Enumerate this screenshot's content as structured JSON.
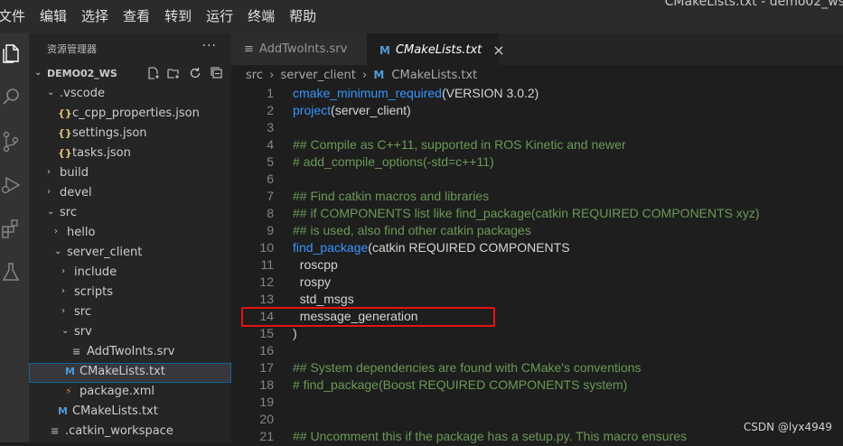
{
  "menubar": [
    "文件",
    "编辑",
    "选择",
    "查看",
    "转到",
    "运行",
    "终端",
    "帮助"
  ],
  "window_title": "CMakeLists.txt - demo02_ws",
  "activity_bar": [
    "explorer-icon",
    "search-icon",
    "source-control-icon",
    "run-debug-icon",
    "extensions-icon",
    "testing-icon"
  ],
  "sidebar": {
    "title": "资源管理器",
    "more": "···",
    "workspace": "DEMO02_WS",
    "tree": [
      {
        "label": ".vscode",
        "chevron": "⌄",
        "icon": ""
      },
      {
        "label": "c_cpp_properties.json",
        "chevron": "",
        "icon": "{}"
      },
      {
        "label": "settings.json",
        "chevron": "",
        "icon": "{}"
      },
      {
        "label": "tasks.json",
        "chevron": "",
        "icon": "{}"
      },
      {
        "label": "build",
        "chevron": "›",
        "icon": ""
      },
      {
        "label": "devel",
        "chevron": "›",
        "icon": ""
      },
      {
        "label": "src",
        "chevron": "⌄",
        "icon": ""
      },
      {
        "label": "hello",
        "chevron": "›",
        "icon": ""
      },
      {
        "label": "server_client",
        "chevron": "⌄",
        "icon": ""
      },
      {
        "label": "include",
        "chevron": "›",
        "icon": ""
      },
      {
        "label": "scripts",
        "chevron": "›",
        "icon": ""
      },
      {
        "label": "src",
        "chevron": "›",
        "icon": ""
      },
      {
        "label": "srv",
        "chevron": "⌄",
        "icon": ""
      },
      {
        "label": "AddTwoInts.srv",
        "chevron": "",
        "icon": "≡"
      },
      {
        "label": "CMakeLists.txt",
        "chevron": "",
        "icon": "M"
      },
      {
        "label": "package.xml",
        "chevron": "",
        "icon": "⚡"
      },
      {
        "label": "CMakeLists.txt",
        "chevron": "",
        "icon": "M"
      },
      {
        "label": ".catkin_workspace",
        "chevron": "",
        "icon": "≡"
      }
    ]
  },
  "tabs": [
    {
      "label": "AddTwoInts.srv",
      "icon": "≡"
    },
    {
      "label": "CMakeLists.txt",
      "icon": "M",
      "close": "×"
    }
  ],
  "breadcrumb": {
    "parts": [
      "src",
      "server_client",
      "CMakeLists.txt"
    ],
    "sep": "›"
  },
  "code_lines": [
    {
      "n": "1",
      "segs": [
        {
          "t": "cmake_minimum_required",
          "c": "kw"
        },
        {
          "t": "(VERSION 3.0.2)",
          "c": "plain"
        }
      ]
    },
    {
      "n": "2",
      "segs": [
        {
          "t": "project",
          "c": "kw"
        },
        {
          "t": "(server_client)",
          "c": "plain"
        }
      ]
    },
    {
      "n": "3",
      "segs": []
    },
    {
      "n": "4",
      "segs": [
        {
          "t": "## Compile as C++11, supported in ROS Kinetic and newer",
          "c": "cm"
        }
      ]
    },
    {
      "n": "5",
      "segs": [
        {
          "t": "# add_compile_options(-std=c++11)",
          "c": "cm"
        }
      ]
    },
    {
      "n": "6",
      "segs": []
    },
    {
      "n": "7",
      "segs": [
        {
          "t": "## Find catkin macros and libraries",
          "c": "cm"
        }
      ]
    },
    {
      "n": "8",
      "segs": [
        {
          "t": "## if COMPONENTS list like find_package(catkin REQUIRED COMPONENTS xyz)",
          "c": "cm"
        }
      ]
    },
    {
      "n": "9",
      "segs": [
        {
          "t": "## is used, also find other catkin packages",
          "c": "cm"
        }
      ]
    },
    {
      "n": "10",
      "segs": [
        {
          "t": "find_package",
          "c": "kw"
        },
        {
          "t": "(catkin REQUIRED COMPONENTS",
          "c": "plain"
        }
      ]
    },
    {
      "n": "11",
      "segs": [
        {
          "t": "  roscpp",
          "c": "plain"
        }
      ]
    },
    {
      "n": "12",
      "segs": [
        {
          "t": "  rospy",
          "c": "plain"
        }
      ]
    },
    {
      "n": "13",
      "segs": [
        {
          "t": "  std_msgs",
          "c": "plain"
        }
      ]
    },
    {
      "n": "14",
      "segs": [
        {
          "t": "  message_generation",
          "c": "plain"
        }
      ]
    },
    {
      "n": "15",
      "segs": [
        {
          "t": ")",
          "c": "plain"
        }
      ]
    },
    {
      "n": "16",
      "segs": []
    },
    {
      "n": "17",
      "segs": [
        {
          "t": "## System dependencies are found with CMake's conventions",
          "c": "cm"
        }
      ]
    },
    {
      "n": "18",
      "segs": [
        {
          "t": "# find_package(Boost REQUIRED COMPONENTS system)",
          "c": "cm"
        }
      ]
    },
    {
      "n": "19",
      "segs": []
    },
    {
      "n": "20",
      "segs": []
    },
    {
      "n": "21",
      "segs": [
        {
          "t": "## Uncomment this if the package has a setup.py. This macro ensures",
          "c": "cm"
        }
      ]
    }
  ],
  "watermark": "CSDN @lyx4949"
}
